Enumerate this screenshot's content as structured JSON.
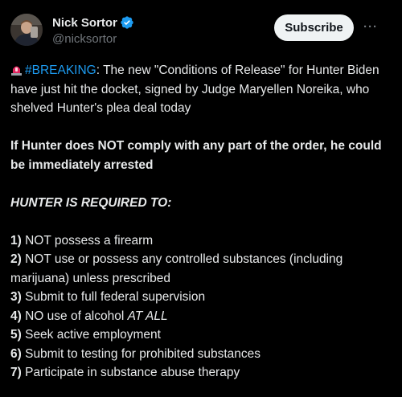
{
  "author": {
    "name": "Nick Sortor",
    "handle": "@nicksortor",
    "verified": true
  },
  "header": {
    "subscribe_label": "Subscribe",
    "more_label": "···"
  },
  "tweet": {
    "emoji": "siren-icon",
    "hashtag": "#BREAKING",
    "intro_rest": ": The new \"Conditions of Release\" for Hunter Biden have just hit the docket, signed by Judge Maryellen Noreika, who shelved Hunter's plea deal today",
    "warning": "If Hunter does NOT comply with any part of the order, he could be immediately arrested",
    "required_heading": "HUNTER IS REQUIRED TO:",
    "items": [
      {
        "num": "1)",
        "text": " NOT possess a firearm"
      },
      {
        "num": "2)",
        "text": " NOT use or possess any controlled substances (including marijuana) unless prescribed"
      },
      {
        "num": "3)",
        "text": " Submit to full federal supervision"
      },
      {
        "num": "4)",
        "text": " NO use of alcohol ",
        "emphasis": "AT ALL"
      },
      {
        "num": "5)",
        "text": " Seek active employment"
      },
      {
        "num": "6)",
        "text": " Submit to testing for prohibited substances"
      },
      {
        "num": "7)",
        "text": " Participate in substance abuse therapy"
      }
    ]
  },
  "colors": {
    "background": "#000000",
    "text": "#e7e9ea",
    "secondary": "#71767b",
    "link": "#1d9bf0",
    "verified": "#1d9bf0",
    "button_bg": "#eff3f4"
  }
}
